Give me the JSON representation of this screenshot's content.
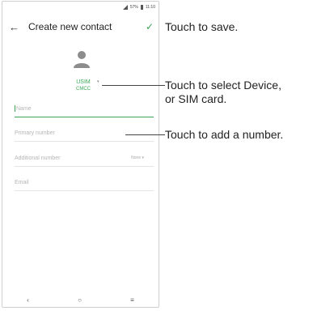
{
  "status": {
    "battery": "57%",
    "time": "11:10"
  },
  "appbar": {
    "back_icon": "←",
    "title": "Create new contact",
    "save_icon": "✓"
  },
  "account": {
    "primary": "USIM",
    "secondary": "CMCC",
    "dropdown_icon": "▾"
  },
  "fields": {
    "name": {
      "placeholder": "Name"
    },
    "primary_number": {
      "placeholder": "Primary number"
    },
    "additional_number": {
      "placeholder": "Additional number",
      "type_value": "None ▾"
    },
    "email": {
      "placeholder": "Email"
    }
  },
  "navbar": {
    "back": "‹",
    "home": "○",
    "menu": "≡"
  },
  "annotations": {
    "save": "Touch to save.",
    "select_line1": "Touch to select Device,",
    "select_line2": "or SIM card.",
    "add_number": "Touch to add a number."
  },
  "colors": {
    "accent": "#3aa655"
  }
}
